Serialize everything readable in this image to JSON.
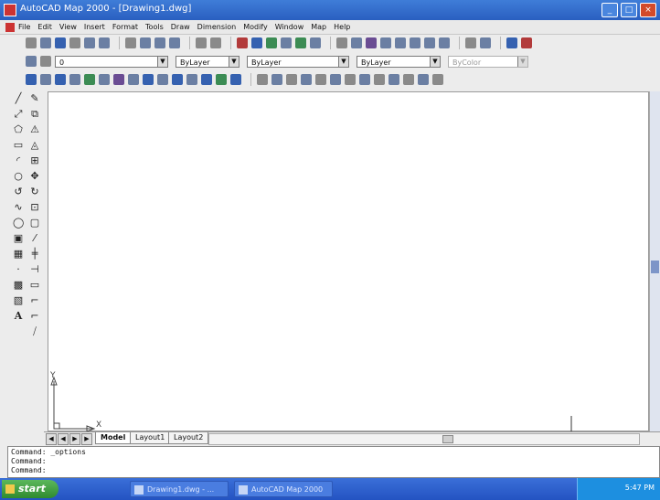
{
  "window": {
    "title": "AutoCAD Map 2000 - [Drawing1.dwg]",
    "minimize_glyph": "_",
    "maximize_glyph": "□",
    "close_glyph": "×"
  },
  "menubar": {
    "items": [
      "File",
      "Edit",
      "View",
      "Insert",
      "Format",
      "Tools",
      "Draw",
      "Dimension",
      "Modify",
      "Window",
      "Map",
      "Help"
    ]
  },
  "properties_toolbar": {
    "layer_value": "0",
    "color_value": "ByLayer",
    "linetype_value": "ByLayer",
    "lineweight_value": "ByLayer",
    "plotstyle_value": "ByColor"
  },
  "left_toolbars": {
    "draw_glyphs": [
      "╱",
      "⤢",
      "⬠",
      "▭",
      "◜",
      "○",
      "↺",
      "∿",
      "◯",
      "▣",
      "▦",
      "·",
      "▩",
      "▧",
      "A"
    ],
    "modify_glyphs": [
      "✎",
      "⧉",
      "⚠",
      "◬",
      "⊞",
      "✥",
      "↻",
      "⊡",
      "▢",
      "⁄",
      "╪",
      "⊣",
      "▭",
      "⌐",
      "⌐",
      "⧸"
    ]
  },
  "drawing": {
    "ucs_y_label": "Y",
    "ucs_x_label": "X"
  },
  "tabs": {
    "nav": [
      "◀",
      "◀",
      "▶",
      "▶"
    ],
    "items": [
      {
        "label": "Model",
        "active": true
      },
      {
        "label": "Layout1",
        "active": false
      },
      {
        "label": "Layout2",
        "active": false
      }
    ]
  },
  "command_line": {
    "lines": [
      "Command: _options",
      "Command:",
      "Command:"
    ]
  },
  "taskbar": {
    "start_label": "start",
    "tasks": [
      "Drawing1.dwg - ...",
      "AutoCAD Map 2000"
    ],
    "clock": "5:47 PM"
  },
  "colors": {
    "titlebar": "#2a5fc0",
    "taskbar": "#2453c2",
    "start_button": "#2f8a2f",
    "drawing_background": "#ffffff"
  }
}
